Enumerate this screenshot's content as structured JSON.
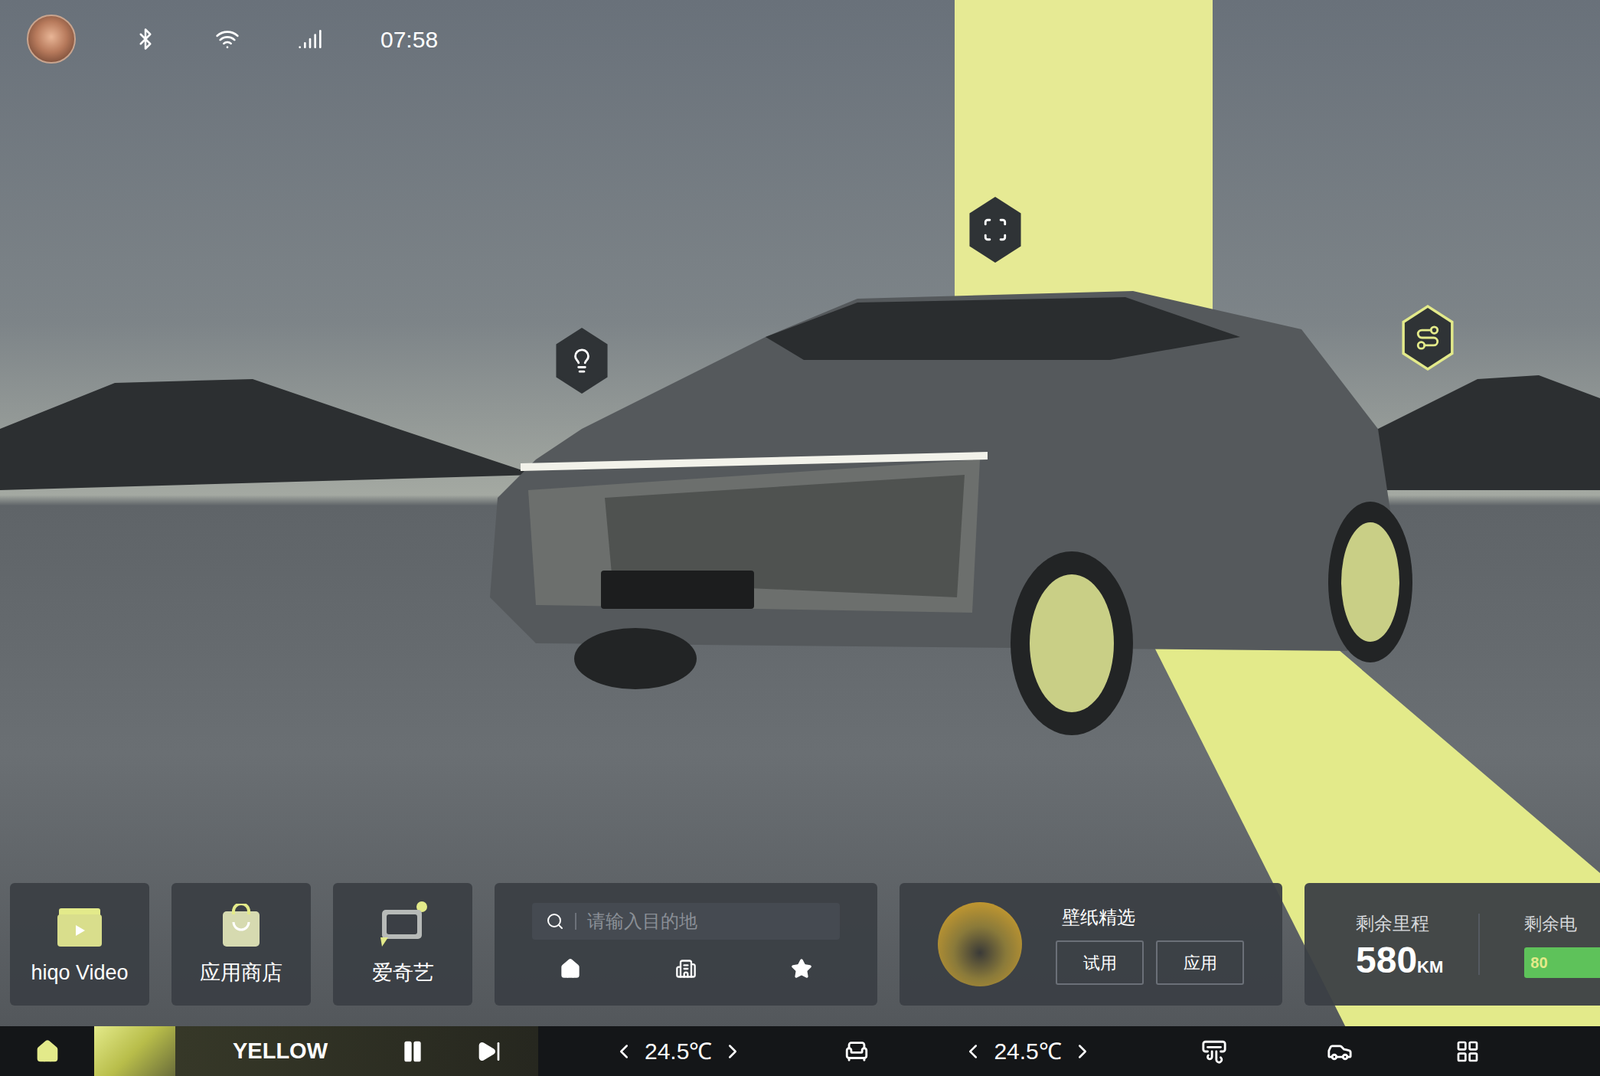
{
  "status_bar": {
    "time": "07:58"
  },
  "hotspots": [
    {
      "highlighted": false
    },
    {
      "highlighted": false
    },
    {
      "highlighted": true
    }
  ],
  "apps": [
    {
      "label": "hiqo Video"
    },
    {
      "label": "应用商店"
    },
    {
      "label": "爱奇艺"
    }
  ],
  "navigation": {
    "placeholder": "请输入目的地"
  },
  "wallpaper": {
    "title": "壁纸精选",
    "buttons": [
      "试用",
      "应用"
    ]
  },
  "range": {
    "label": "剩余里程",
    "value": "580",
    "unit": "KM"
  },
  "battery": {
    "label": "剩余电",
    "reading": "80",
    "level": 0.8
  },
  "media": {
    "title": "YELLOW",
    "playing": true
  },
  "climate": {
    "left_temp": "24.5℃",
    "right_temp": "24.5℃"
  }
}
